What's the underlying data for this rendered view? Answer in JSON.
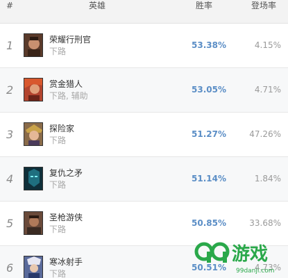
{
  "header": {
    "rank_label": "#",
    "hero_label": "英雄",
    "winrate_label": "胜率",
    "pickrate_label": "登场率"
  },
  "rows": [
    {
      "rank": "1",
      "name": "荣耀行刑官",
      "position": "下路",
      "winrate": "53.38%",
      "pickrate": "4.15%",
      "portrait_color": "#5a3a2a"
    },
    {
      "rank": "2",
      "name": "赏金猎人",
      "position": "下路, 辅助",
      "winrate": "53.05%",
      "pickrate": "4.71%",
      "portrait_color": "#b2442e"
    },
    {
      "rank": "3",
      "name": "探险家",
      "position": "下路",
      "winrate": "51.27%",
      "pickrate": "47.26%",
      "portrait_color": "#8a6b4a"
    },
    {
      "rank": "4",
      "name": "复仇之矛",
      "position": "下路",
      "winrate": "51.14%",
      "pickrate": "1.84%",
      "portrait_color": "#1f5f6f"
    },
    {
      "rank": "5",
      "name": "圣枪游侠",
      "position": "下路",
      "winrate": "50.85%",
      "pickrate": "33.68%",
      "portrait_color": "#6a4a3a"
    },
    {
      "rank": "6",
      "name": "寒冰射手",
      "position": "下路",
      "winrate": "50.51%",
      "pickrate": "4.73%",
      "portrait_color": "#5a6a9a"
    }
  ],
  "watermark": {
    "brand": "游戏",
    "site": "99danji.com",
    "color": "#2aa84a"
  }
}
